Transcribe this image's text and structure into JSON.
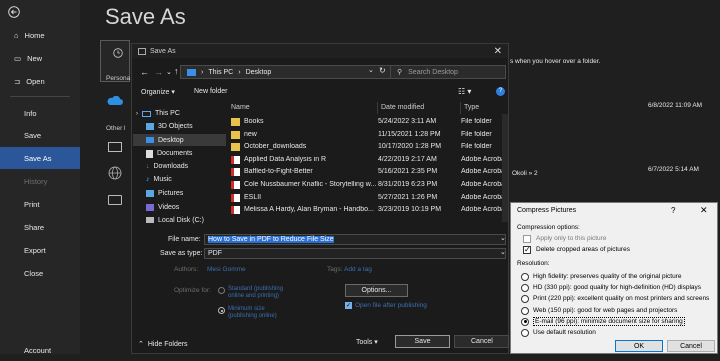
{
  "backstage": {
    "title": "Save As",
    "rail": {
      "home": "Home",
      "new": "New",
      "open": "Open",
      "info": "Info",
      "save": "Save",
      "save_as": "Save As",
      "history": "History",
      "print": "Print",
      "share": "Share",
      "export": "Export",
      "close": "Close",
      "account": "Account"
    },
    "personal_label": "Persona",
    "other_label": "Other l",
    "hint": "s when you hover over a folder.",
    "stamp1": "6/8/2022 11:09 AM",
    "stamp2": "6/7/2022 5:14 AM",
    "okoli": "Okoli » 2"
  },
  "dialog": {
    "title": "Save As",
    "address": {
      "part1": "This PC",
      "sep": "›",
      "part2": "Desktop"
    },
    "search_placeholder": "Search Desktop",
    "organize": "Organize",
    "new_folder": "New folder",
    "nav": [
      {
        "label": "This PC"
      },
      {
        "label": "3D Objects"
      },
      {
        "label": "Desktop"
      },
      {
        "label": "Documents"
      },
      {
        "label": "Downloads"
      },
      {
        "label": "Music"
      },
      {
        "label": "Pictures"
      },
      {
        "label": "Videos"
      },
      {
        "label": "Local Disk (C:)"
      }
    ],
    "columns": {
      "name": "Name",
      "date": "Date modified",
      "type": "Type"
    },
    "files": [
      {
        "name": "Books",
        "date": "5/24/2022 3:11 AM",
        "type": "File folder",
        "kind": "folder"
      },
      {
        "name": "new",
        "date": "11/15/2021 1:28 PM",
        "type": "File folder",
        "kind": "folder"
      },
      {
        "name": "October_downloads",
        "date": "10/17/2020 1:28 PM",
        "type": "File folder",
        "kind": "folder"
      },
      {
        "name": "Applied Data Analysis in R",
        "date": "4/22/2019 2:17 AM",
        "type": "Adobe Acrobat",
        "kind": "pdf"
      },
      {
        "name": "Baffled-to-Fight-Better",
        "date": "5/16/2021 2:35 PM",
        "type": "Adobe Acrobat",
        "kind": "pdf"
      },
      {
        "name": "Cole Nussbaumer Knaflic - Storytelling w...",
        "date": "8/31/2019 6:23 PM",
        "type": "Adobe Acrobat",
        "kind": "pdf"
      },
      {
        "name": "ESLII",
        "date": "5/27/2021 1:26 PM",
        "type": "Adobe Acrobat",
        "kind": "pdf"
      },
      {
        "name": "Melissa A Hardy, Alan Bryman - Handbo...",
        "date": "3/23/2019 10:19 PM",
        "type": "Adobe Acrobat",
        "kind": "pdf"
      }
    ],
    "file_name_label": "File name:",
    "file_name_value": "How to Save in PDF to Reduce File Size",
    "save_type_label": "Save as type:",
    "save_type_value": "PDF",
    "authors_label": "Authors:",
    "authors_value": "Mesi Gomme",
    "tags_label": "Tags:",
    "tags_value": "Add a tag",
    "optimize_label": "Optimize for:",
    "opt_standard": "Standard (publishing online and printing)",
    "opt_minimum": "Minimum size (publishing online)",
    "options_button": "Options...",
    "open_after": "Open file after publishing",
    "hide_folders": "Hide Folders",
    "tools": "Tools",
    "save_button": "Save",
    "cancel_button": "Cancel"
  },
  "compress": {
    "title": "Compress Pictures",
    "help": "?",
    "compression_options": "Compression options:",
    "apply_only": "Apply only to this picture",
    "delete_cropped": "Delete cropped areas of pictures",
    "resolution": "Resolution:",
    "options": [
      "High fidelity: preserves quality of the original picture",
      "HD (330 ppi): good quality for high-definition (HD) displays",
      "Print (220 ppi): excellent quality on most printers and screens",
      "Web (150 ppi): good for web pages and projectors",
      "E-mail (96 ppi): minimize document size for sharing",
      "Use default resolution"
    ],
    "selected_index": 4,
    "ok": "OK",
    "cancel": "Cancel"
  }
}
